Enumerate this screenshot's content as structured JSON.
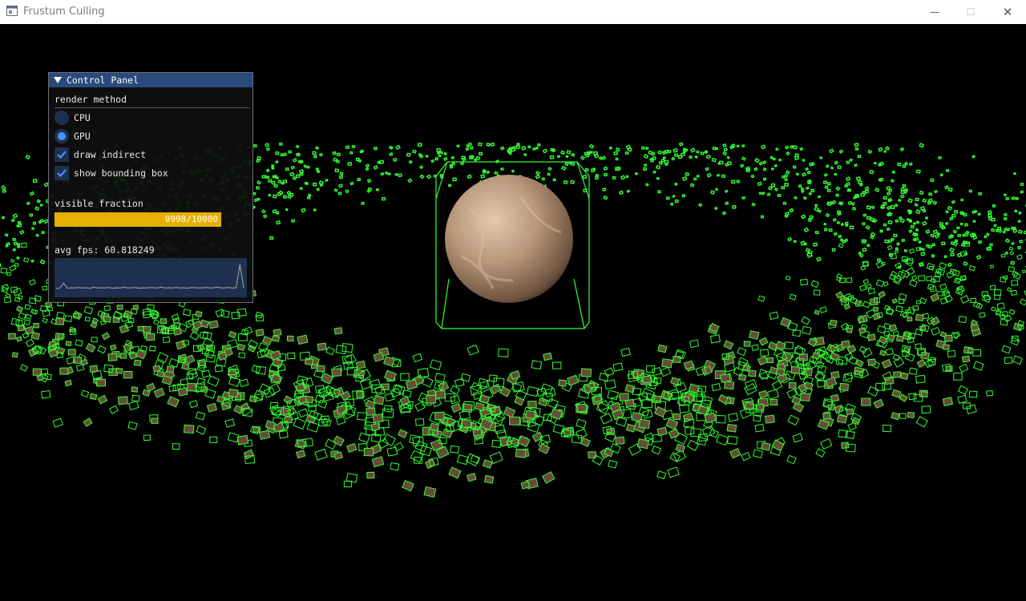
{
  "window": {
    "title": "Frustum Culling",
    "minimize_glyph": "—",
    "maximize_glyph": "☐",
    "close_glyph": "✕"
  },
  "panel": {
    "title": "Control Panel",
    "section_label": "render method",
    "options": {
      "cpu_label": "CPU",
      "gpu_label": "GPU",
      "selected": "GPU"
    },
    "draw_indirect_label": "draw indirect",
    "draw_indirect_checked": true,
    "show_bbox_label": "show bounding box",
    "show_bbox_checked": true,
    "visible_fraction_label": "visible fraction",
    "visible_count": 9998,
    "total_count": 10000,
    "visible_fraction_text": "9998/10000",
    "avg_fps_text": "avg fps: 60.818249",
    "fps_history": [
      60.4,
      60.6,
      62.4,
      60.5,
      60.7,
      60.6,
      60.8,
      60.6,
      60.7,
      60.5,
      60.9,
      60.6,
      60.7,
      60.6,
      60.8,
      60.5,
      60.7,
      60.6,
      60.9,
      60.6,
      60.7,
      60.8,
      60.5,
      60.7,
      60.6,
      60.8,
      60.7,
      60.6,
      60.9,
      60.6,
      60.7,
      60.6,
      60.8,
      60.6,
      60.7,
      60.5,
      60.8,
      60.7,
      60.6,
      60.7,
      60.8,
      60.6,
      60.7,
      60.9,
      60.6,
      60.7,
      60.8,
      60.6,
      60.7,
      69.5,
      60.6
    ]
  },
  "colors": {
    "accent": "#4296fa",
    "progress": "#e6b000",
    "header": "#294a7a",
    "bbox": "#32ff32",
    "planet": "#b9977a"
  }
}
